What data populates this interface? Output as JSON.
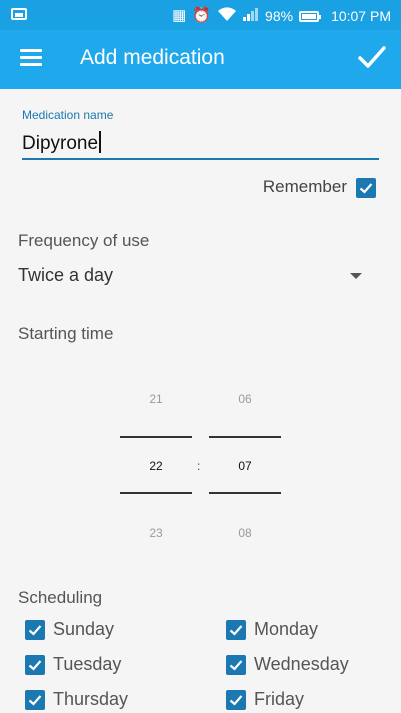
{
  "status_bar": {
    "battery": "98%",
    "time": "10:07 PM",
    "icons": [
      "image-icon",
      "vibrate-icon",
      "alarm-icon",
      "wifi-icon",
      "signal-icon",
      "battery-icon"
    ]
  },
  "app_bar": {
    "title": "Add medication",
    "icons": [
      "menu-icon",
      "checkmark-icon"
    ]
  },
  "medication_name": {
    "label": "Medication name",
    "value": "Dipyrone"
  },
  "remember": {
    "label": "Remember",
    "checked": true
  },
  "frequency": {
    "label": "Frequency of use",
    "value": "Twice a day"
  },
  "starting_time": {
    "label": "Starting time",
    "hour_prev": "21",
    "hour": "22",
    "hour_next": "23",
    "minute_prev": "06",
    "minute": "07",
    "minute_next": "08",
    "separator": ":"
  },
  "scheduling": {
    "label": "Scheduling",
    "days": [
      {
        "label": "Sunday",
        "checked": true
      },
      {
        "label": "Monday",
        "checked": true
      },
      {
        "label": "Tuesday",
        "checked": true
      },
      {
        "label": "Wednesday",
        "checked": true
      },
      {
        "label": "Thursday",
        "checked": true
      },
      {
        "label": "Friday",
        "checked": true
      }
    ]
  },
  "colors": {
    "app_bar": "#1fa8ec",
    "status_bar": "#1aa1e3",
    "accent": "#1b78b0",
    "background": "#f5f5f5"
  }
}
